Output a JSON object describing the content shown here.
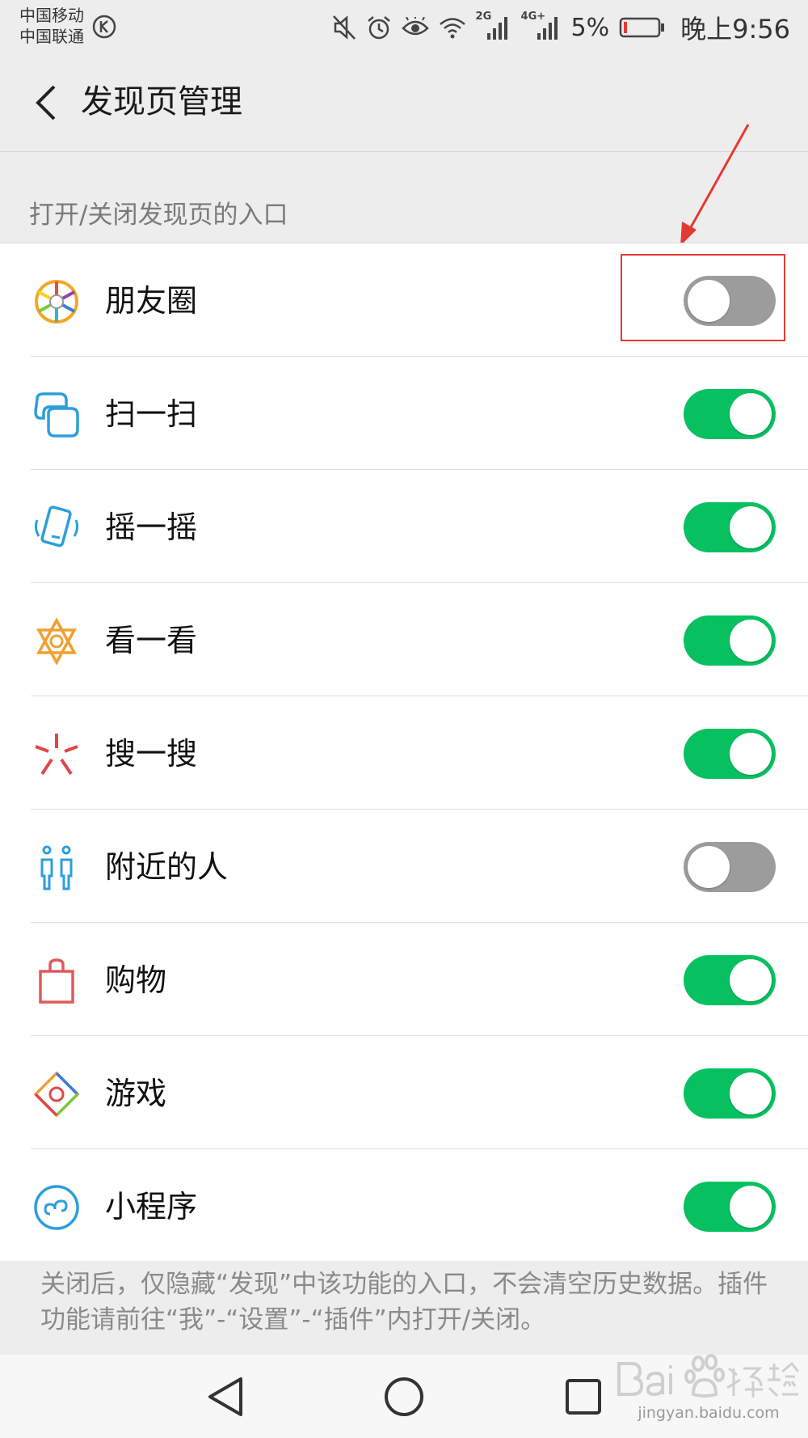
{
  "status_bar": {
    "carrier_1": "中国移动",
    "carrier_2": "中国联通",
    "net_2g": "2G",
    "net_4g": "4G+",
    "battery_percent": "5%",
    "time": "晚上9:56"
  },
  "header": {
    "title": "发现页管理"
  },
  "section_label": "打开/关闭发现页的入口",
  "items": [
    {
      "label": "朋友圈",
      "icon": "moments-aperture-icon",
      "enabled": false
    },
    {
      "label": "扫一扫",
      "icon": "scan-icon",
      "enabled": true
    },
    {
      "label": "摇一摇",
      "icon": "shake-icon",
      "enabled": true
    },
    {
      "label": "看一看",
      "icon": "top-stories-icon",
      "enabled": true
    },
    {
      "label": "搜一搜",
      "icon": "search-spark-icon",
      "enabled": true
    },
    {
      "label": "附近的人",
      "icon": "people-nearby-icon",
      "enabled": false
    },
    {
      "label": "购物",
      "icon": "shopping-bag-icon",
      "enabled": true
    },
    {
      "label": "游戏",
      "icon": "games-icon",
      "enabled": true
    },
    {
      "label": "小程序",
      "icon": "mini-program-icon",
      "enabled": true
    }
  ],
  "footer_note": "关闭后，仅隐藏“发现”中该功能的入口，不会清空历史数据。插件功能请前往“我”-“设置”-“插件”内打开/关闭。",
  "colors": {
    "toggle_on": "#07c160",
    "toggle_off": "#9c9c9c",
    "annotation": "#e53935"
  },
  "watermark": {
    "text_url": "jingyan.baidu.com"
  }
}
